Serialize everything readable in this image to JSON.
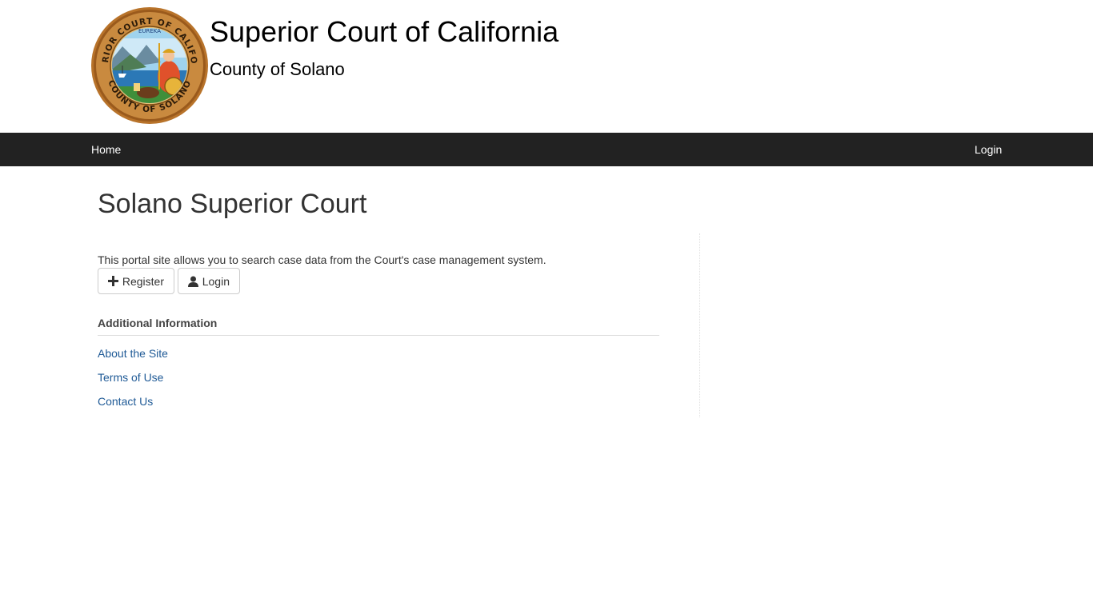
{
  "header": {
    "title": "Superior Court of California",
    "subtitle": "County of Solano",
    "seal": {
      "top_text": "SUPERIOR COURT OF CALIFORNIA",
      "bottom_text": "COUNTY OF SOLANO",
      "motto": "EUREKA"
    }
  },
  "navbar": {
    "home_label": "Home",
    "login_label": "Login",
    "background": "#222222"
  },
  "main": {
    "page_title": "Solano Superior Court",
    "intro_text": "This portal site allows you to search case data from the Court's case management system.",
    "buttons": {
      "register_label": "Register",
      "register_icon": "plus-icon",
      "login_label": "Login",
      "login_icon": "user-icon"
    },
    "additional_info": {
      "heading": "Additional Information",
      "links": [
        {
          "label": "About the Site"
        },
        {
          "label": "Terms of Use"
        },
        {
          "label": "Contact Us"
        }
      ]
    }
  },
  "colors": {
    "link": "#1f5a96",
    "text": "#333333"
  }
}
